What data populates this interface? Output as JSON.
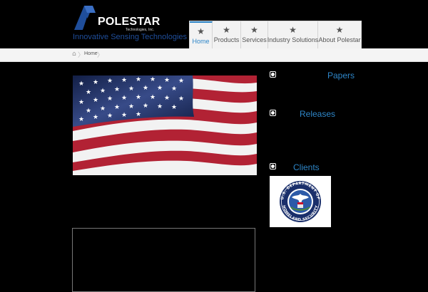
{
  "brand": {
    "name": "POLESTAR",
    "sub": "Technologies, Inc.",
    "tagline": "Innovative Sensing Technologies"
  },
  "nav": {
    "items": [
      {
        "label": "Home",
        "active": true
      },
      {
        "label": "Products",
        "active": false
      },
      {
        "label": "Services",
        "active": false
      },
      {
        "label": "Industry Solutions",
        "active": false
      },
      {
        "label": "About Polestar",
        "active": false
      }
    ],
    "icon": "star-icon"
  },
  "breadcrumb": {
    "home_icon": "home-icon",
    "current": "Home"
  },
  "sidebar": {
    "papers": "Papers",
    "releases": "Releases",
    "clients": "Clients"
  },
  "client_logo": {
    "top_text": "U.S. DEPARTMENT OF",
    "bottom_text": "HOMELAND SECURITY"
  },
  "colors": {
    "accent": "#2e86c8",
    "brand_blue": "#1f4e9b",
    "background": "#000000"
  }
}
